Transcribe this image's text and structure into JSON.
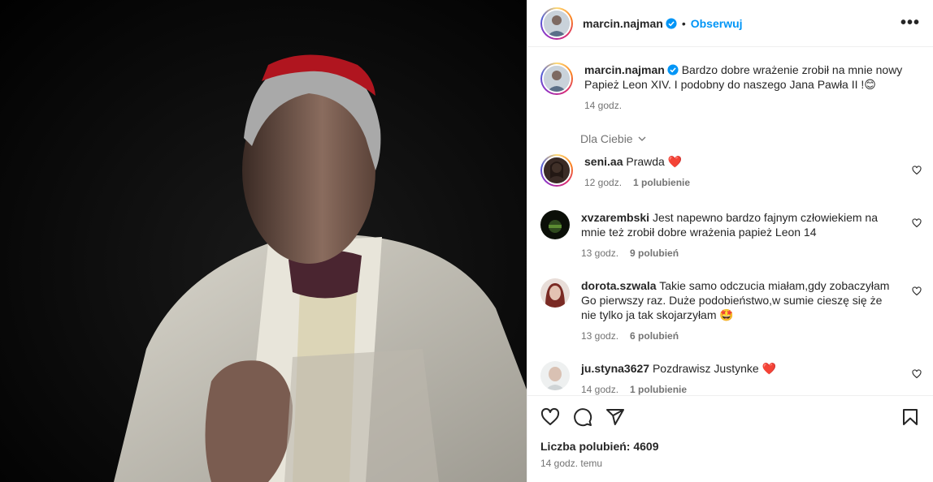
{
  "post": {
    "author": "marcin.najman",
    "follow_label": "Obserwuj",
    "separator": "•",
    "more_label": "•••",
    "caption": "Bardzo dobre wrażenie zrobił na mnie nowy Papież Leon XIV. I podobny do naszego Jana Pawła II !😊",
    "caption_time": "14 godz.",
    "filter_label": "Dla Ciebie"
  },
  "comments": [
    {
      "user": "seni.aa",
      "text": "Prawda ❤️",
      "time": "12 godz.",
      "likes": "1 polubienie"
    },
    {
      "user": "xvzarembski",
      "text": "Jest napewno bardzo fajnym człowiekiem na mnie też zrobił dobre wrażenia papież Leon 14",
      "time": "13 godz.",
      "likes": "9 polubień"
    },
    {
      "user": "dorota.szwala",
      "text": "Takie samo odczucia miałam,gdy zobaczyłam Go pierwszy raz. Duże podobieństwo,w sumie cieszę się że nie tylko ja tak skojarzyłam 🤩",
      "time": "13 godz.",
      "likes": "6 polubień"
    },
    {
      "user": "ju.styna3627",
      "text": "Pozdrawisz Justynke ❤️",
      "time": "14 godz.",
      "likes": "1 polubienie"
    }
  ],
  "footer": {
    "likes_text": "Liczba polubień: 4609",
    "posted_ago": "14 godz. temu"
  },
  "colors": {
    "accent": "#0095f6",
    "verified": "#0095f6",
    "heart": "#ed4956",
    "muted": "#737373"
  }
}
